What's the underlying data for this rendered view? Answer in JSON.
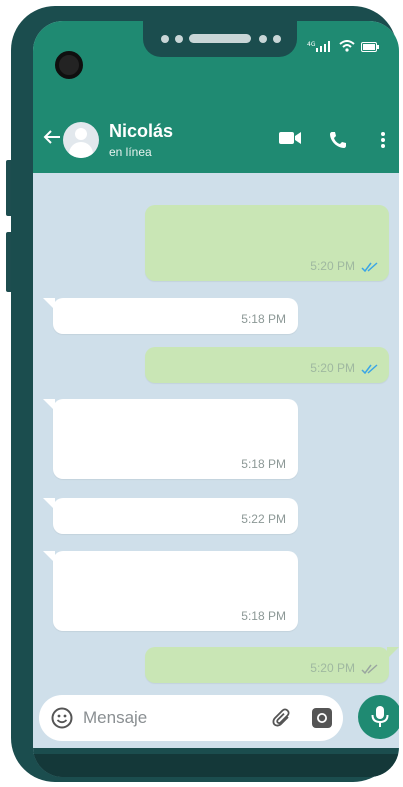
{
  "colors": {
    "header": "#1f8a72",
    "chat_bg": "#cfdfea",
    "outgoing_bubble": "#c9e6b5",
    "incoming_bubble": "#ffffff",
    "read_ticks": "#3aa5e6",
    "frame": "#1b4d4e"
  },
  "header": {
    "contact_name": "Nicolás",
    "contact_status": "en línea",
    "icons": [
      "back-arrow-icon",
      "avatar",
      "video-call-icon",
      "voice-call-icon",
      "more-options-icon"
    ]
  },
  "messages": [
    {
      "direction": "outgoing",
      "time": "5:20 PM",
      "status": "read"
    },
    {
      "direction": "incoming",
      "time": "5:18 PM"
    },
    {
      "direction": "outgoing",
      "time": "5:20 PM",
      "status": "read"
    },
    {
      "direction": "incoming",
      "time": "5:18 PM"
    },
    {
      "direction": "incoming",
      "time": "5:22 PM"
    },
    {
      "direction": "incoming",
      "time": "5:18 PM"
    },
    {
      "direction": "outgoing",
      "time": "5:20 PM",
      "status": "delivered"
    }
  ],
  "composer": {
    "placeholder": "Mensaje",
    "icons": [
      "emoji-icon",
      "attach-icon",
      "camera-icon",
      "mic-icon"
    ]
  }
}
